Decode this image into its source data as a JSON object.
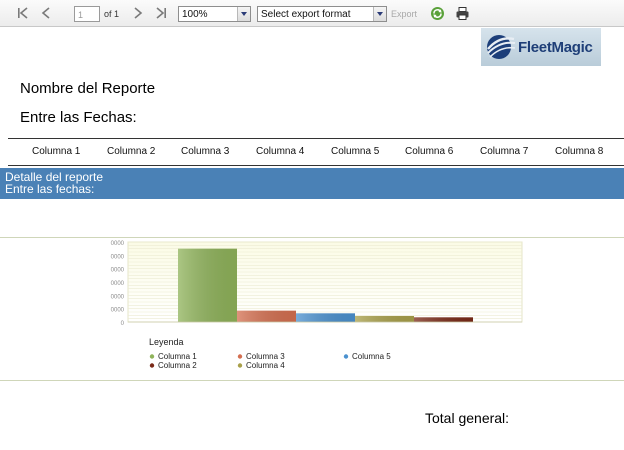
{
  "toolbar": {
    "page_value": "1",
    "page_of": "of 1",
    "zoom": "100%",
    "export_format": "Select export format",
    "export_label": "Export"
  },
  "logo": {
    "text": "FleetMagic"
  },
  "report": {
    "title": "Nombre del Reporte",
    "dates": "Entre las Fechas:"
  },
  "columns": [
    "Columna 1",
    "Columna 2",
    "Columna 3",
    "Columna 4",
    "Columna 5",
    "Columna 6",
    "Columna 7",
    "Columna 8"
  ],
  "detail": {
    "line1": "Detalle del reporte",
    "line2": "Entre las fechas:"
  },
  "footer": {
    "total": "Total general:"
  },
  "chart_data": {
    "type": "bar",
    "title": "",
    "xlabel": "",
    "ylabel": "",
    "y_tick_labels": [
      "0000",
      "0000",
      "0000",
      "0000",
      "0000",
      "0000",
      "0"
    ],
    "ylim": [
      0,
      60000
    ],
    "categories": [
      "Columna 1",
      "Columna 3",
      "Columna 5",
      "Columna 4",
      "Columna 2"
    ],
    "values": [
      55000,
      8500,
      6500,
      4500,
      3500
    ],
    "colors": [
      "#8fb35a",
      "#d46f50",
      "#4b91cf",
      "#a9a04a",
      "#7a2a18"
    ],
    "legend_title": "Leyenda",
    "legend": [
      {
        "name": "Columna 1",
        "color": "#8fb35a"
      },
      {
        "name": "Columna 2",
        "color": "#7a2a18"
      },
      {
        "name": "Columna 3",
        "color": "#d46f50"
      },
      {
        "name": "Columna 4",
        "color": "#a9a04a"
      },
      {
        "name": "Columna 5",
        "color": "#4b91cf"
      }
    ],
    "grid": true
  }
}
